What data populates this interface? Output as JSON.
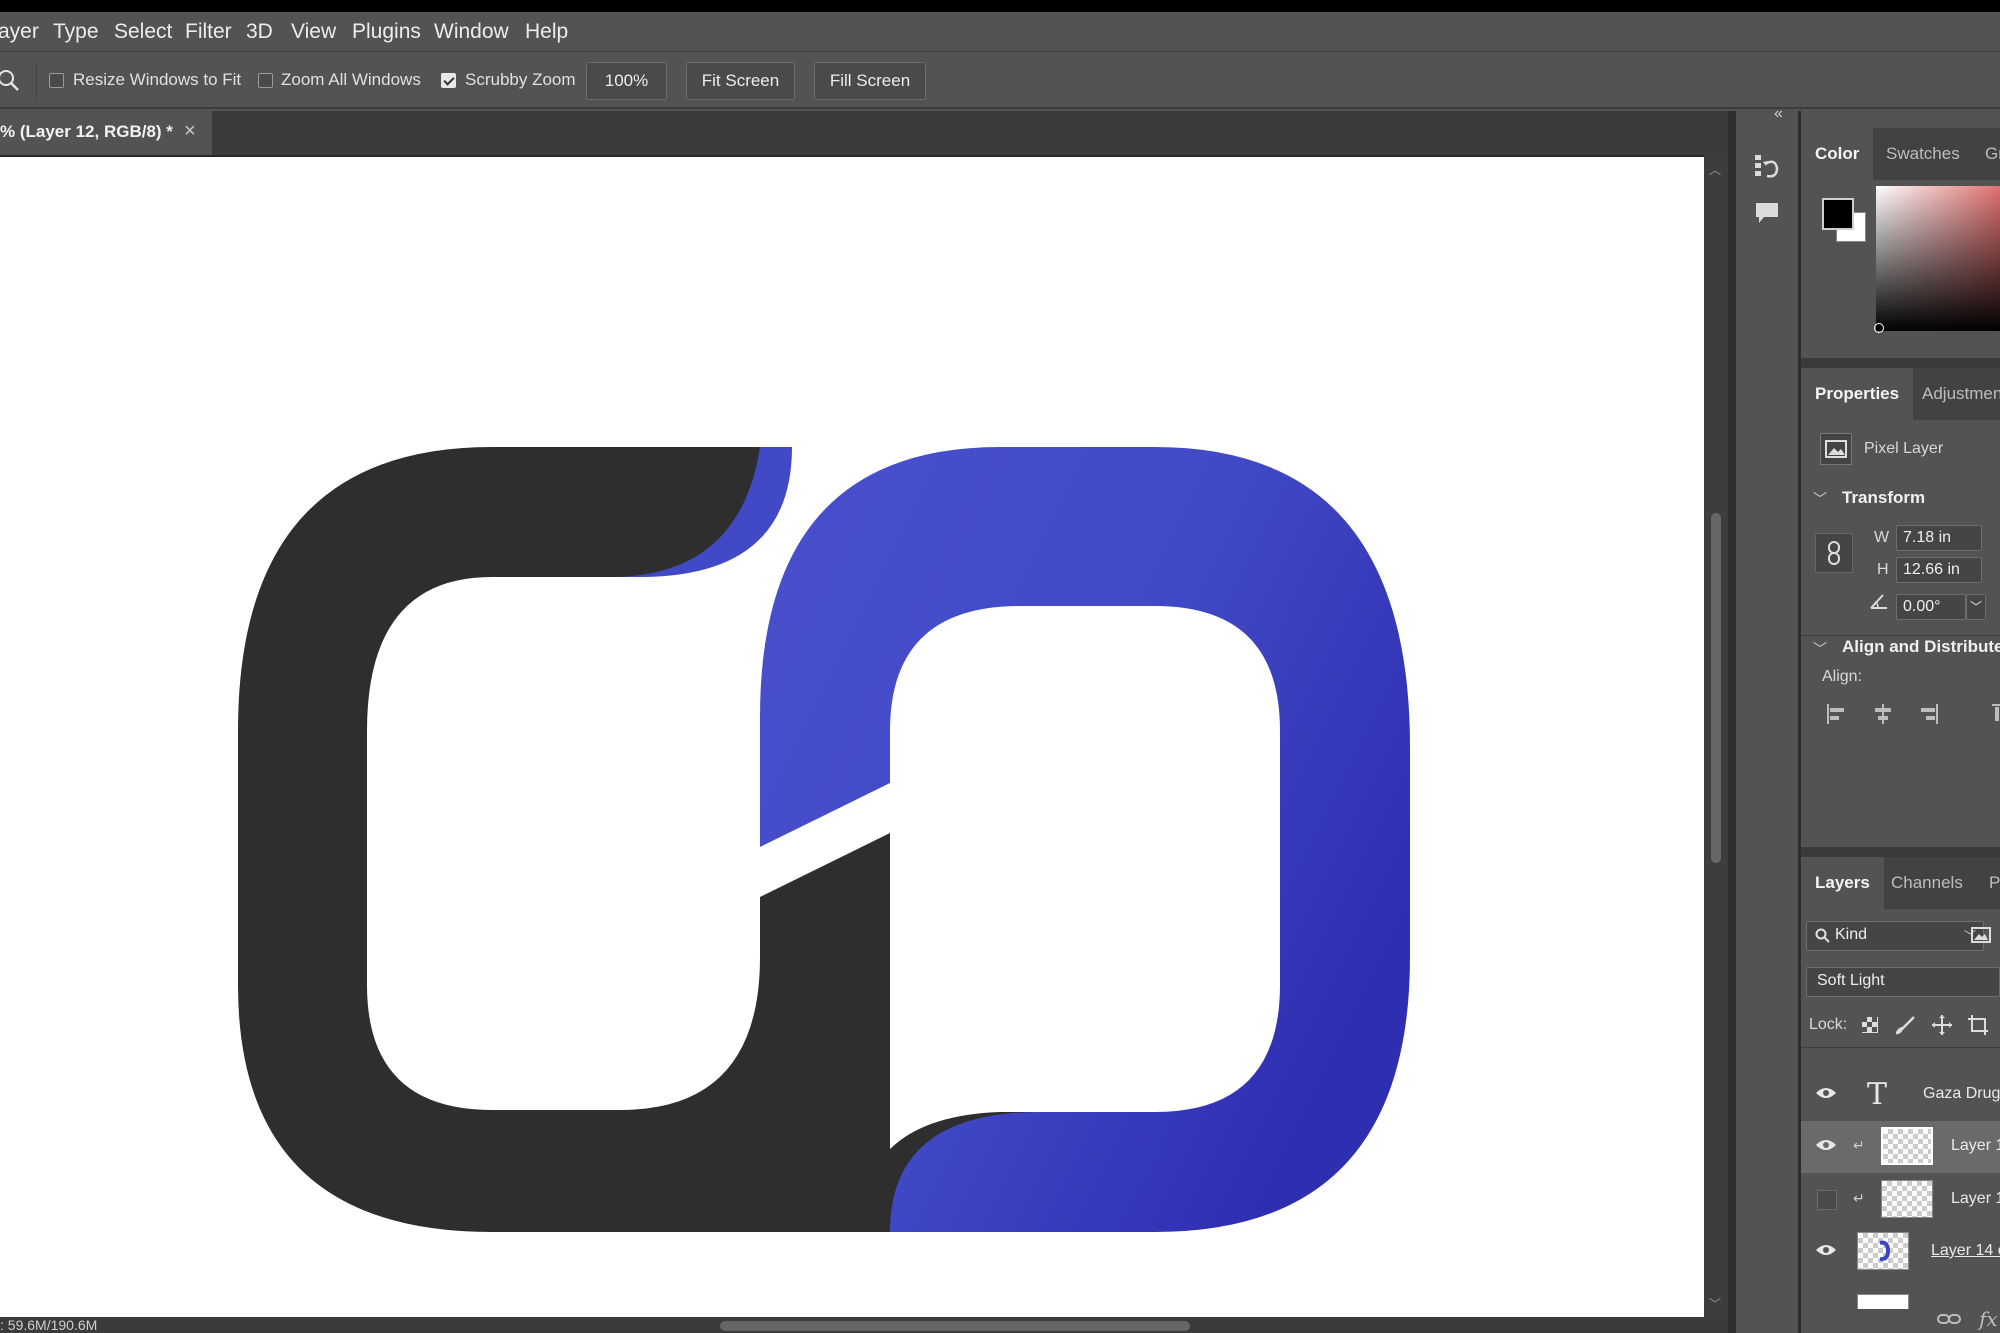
{
  "menu": {
    "items": [
      "ayer",
      "Type",
      "Select",
      "Filter",
      "3D",
      "View",
      "Plugins",
      "Window",
      "Help"
    ]
  },
  "options": {
    "tool_icon": "zoom-icon",
    "resize_windows": {
      "label": "Resize Windows to Fit",
      "checked": false
    },
    "zoom_all": {
      "label": "Zoom All Windows",
      "checked": false
    },
    "scrubby_zoom": {
      "label": "Scrubby Zoom",
      "checked": true
    },
    "zoom_value": "100%",
    "fit_screen": "Fit Screen",
    "fill_screen": "Fill Screen"
  },
  "document": {
    "tab_title": "% (Layer 12, RGB/8) *",
    "close_glyph": "×"
  },
  "status": {
    "text": ": 59.6M/190.6M"
  },
  "logo": {
    "dark_color": "#2e2e2e",
    "blue_color": "#4149c6",
    "blue_dark_color": "#3030b4"
  },
  "panels": {
    "color_tabs": [
      "Color",
      "Swatches",
      "Gr"
    ],
    "properties_tabs": [
      "Properties",
      "Adjustmen"
    ],
    "layer_type": "Pixel Layer",
    "transform": {
      "title": "Transform",
      "w_label": "W",
      "w_value": "7.18 in",
      "h_label": "H",
      "h_value": "12.66 in",
      "angle_value": "0.00°"
    },
    "align": {
      "title": "Align and Distribute",
      "label": "Align:"
    },
    "layers_tabs": [
      "Layers",
      "Channels",
      "P"
    ],
    "filter_kind": "Kind",
    "blend_mode": "Soft Light",
    "lock_label": "Lock:",
    "layers": [
      {
        "name": "Gaza Drug",
        "type": "text",
        "visible": true,
        "selected": false
      },
      {
        "name": "Layer 1",
        "type": "pixel",
        "visible": true,
        "selected": true
      },
      {
        "name": "Layer 1",
        "type": "pixel",
        "visible": false,
        "selected": false
      },
      {
        "name": "Layer 14 c",
        "type": "pixel",
        "visible": true,
        "selected": false
      }
    ],
    "footer_fx": "fx"
  }
}
